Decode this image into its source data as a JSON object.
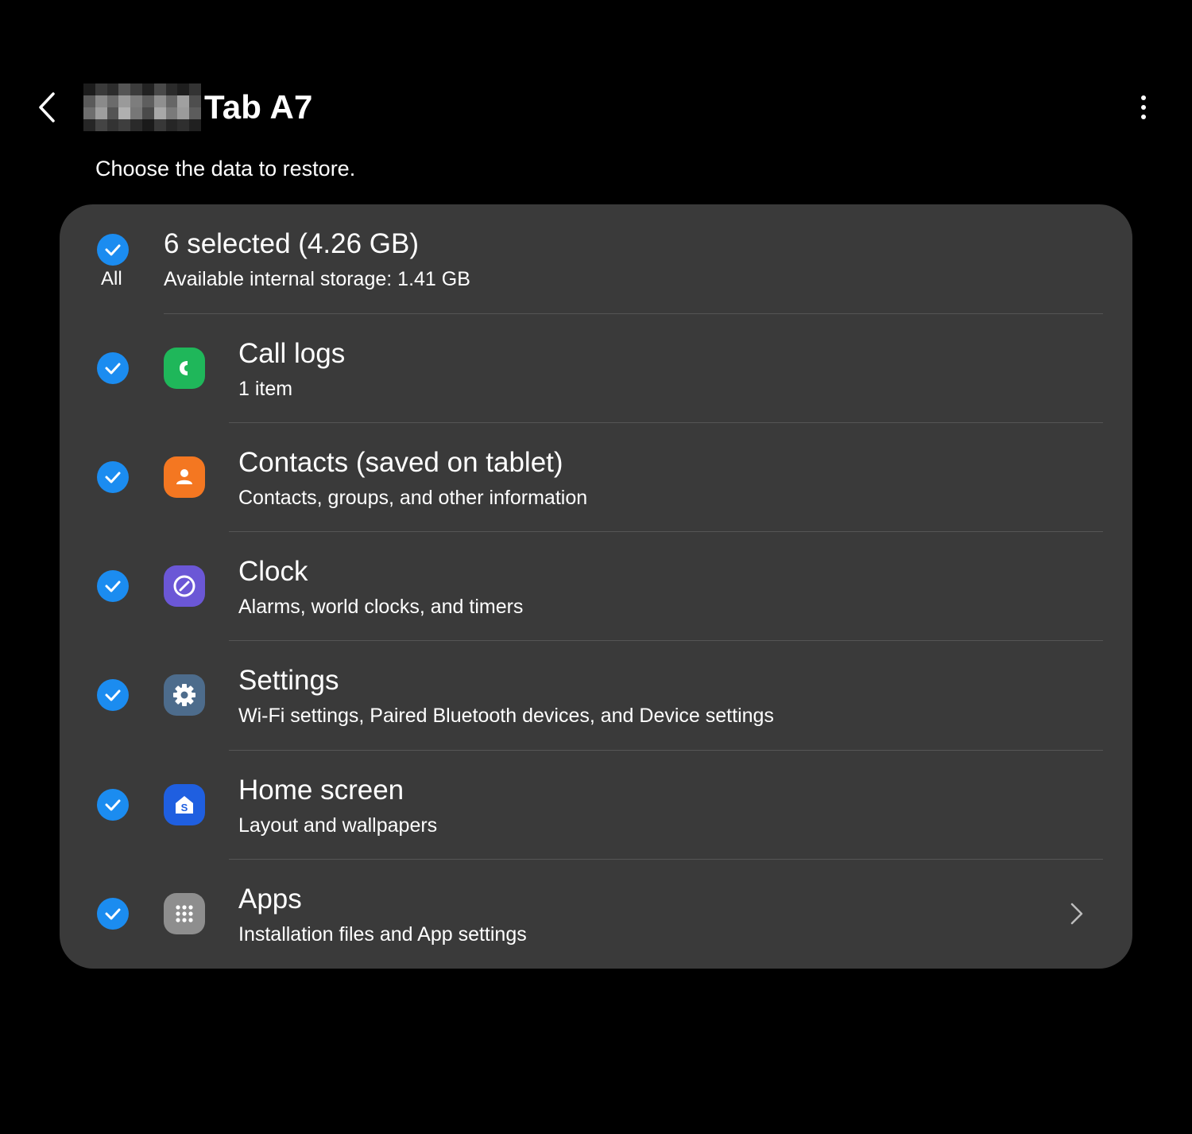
{
  "header": {
    "title": "Tab A7",
    "back_icon": "chevron-left-icon",
    "more_icon": "more-vertical-icon"
  },
  "subtitle": "Choose the data to restore.",
  "summary": {
    "all_label": "All",
    "selected": "6 selected (4.26 GB)",
    "storage": "Available internal storage: 1.41 GB",
    "checked": true
  },
  "items": [
    {
      "title": "Call logs",
      "sub": "1 item",
      "icon": "phone-icon",
      "color": "#1fb75a",
      "checked": true
    },
    {
      "title": "Contacts (saved on tablet)",
      "sub": "Contacts, groups, and other information",
      "icon": "contacts-icon",
      "color": "#f47721",
      "checked": true
    },
    {
      "title": "Clock",
      "sub": "Alarms, world clocks, and timers",
      "icon": "clock-icon",
      "color": "#6b57d6",
      "checked": true
    },
    {
      "title": "Settings",
      "sub": "Wi-Fi settings, Paired Bluetooth devices, and Device settings",
      "icon": "settings-gear-icon",
      "color": "#4d6c8c",
      "checked": true
    },
    {
      "title": "Home screen",
      "sub": "Layout and wallpapers",
      "icon": "home-screen-icon",
      "color": "#1f5fe0",
      "checked": true
    },
    {
      "title": "Apps",
      "sub": "Installation files and App settings",
      "icon": "apps-grid-icon",
      "color": "#8e8e8e",
      "checked": true
    }
  ],
  "colors": {
    "background": "#000000",
    "card": "#3a3a3a",
    "checkbox": "#1b8cf0",
    "divider": "#555555"
  }
}
